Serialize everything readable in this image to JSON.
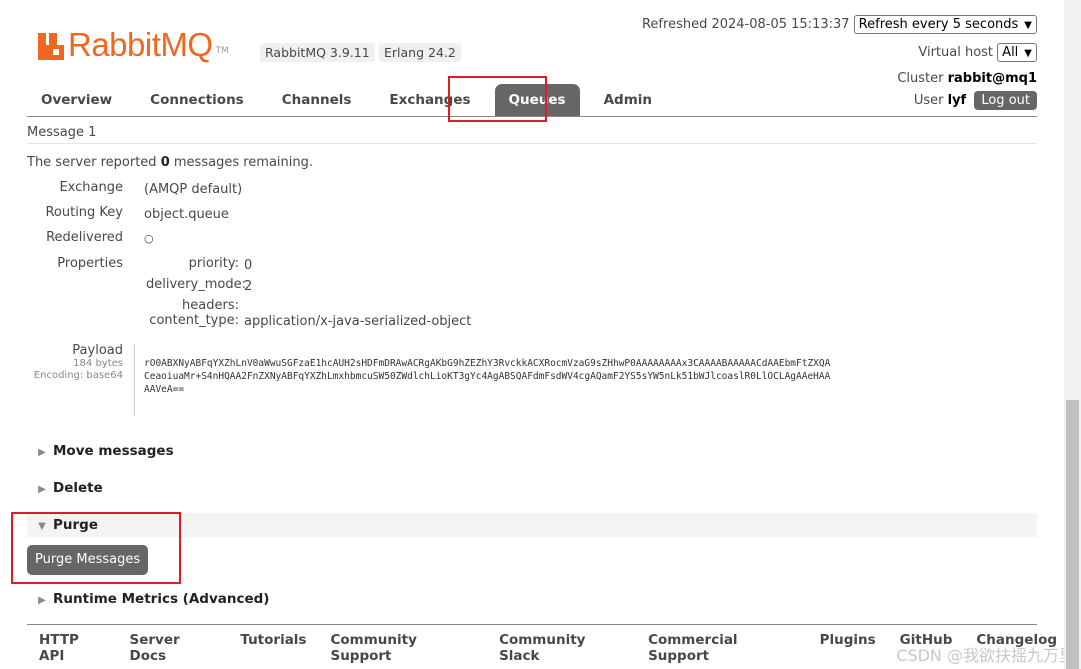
{
  "header": {
    "logo_text": "RabbitMQ",
    "logo_tm": "TM",
    "version": "RabbitMQ 3.9.11",
    "erlang": "Erlang 24.2",
    "refreshed_label": "Refreshed 2024-08-05 15:13:37",
    "refresh_select": "Refresh every 5 seconds",
    "vhost_label": "Virtual host",
    "vhost_select": "All",
    "cluster_label": "Cluster",
    "cluster_value": "rabbit@mq1",
    "user_label": "User",
    "user_value": "lyf",
    "logout_label": "Log out"
  },
  "tabs": [
    "Overview",
    "Connections",
    "Channels",
    "Exchanges",
    "Queues",
    "Admin"
  ],
  "message": {
    "heading": "Message 1",
    "remaining_prefix": "The server reported",
    "remaining_count": "0",
    "remaining_suffix": "messages remaining.",
    "exchange_label": "Exchange",
    "exchange_value": "(AMQP default)",
    "routing_key_label": "Routing Key",
    "routing_key_value": "object.queue",
    "redelivered_label": "Redelivered",
    "redelivered_value": "○",
    "properties_label": "Properties",
    "properties": {
      "priority_label": "priority:",
      "priority_value": "0",
      "delivery_mode_label": "delivery_mode:",
      "delivery_mode_value": "2",
      "headers_label": "headers:",
      "content_type_label": "content_type:",
      "content_type_value": "application/x-java-serialized-object"
    },
    "payload_label": "Payload",
    "payload_bytes": "184 bytes",
    "payload_encoding": "Encoding: base64",
    "payload_lines": [
      "rO0ABXNyABFqYXZhLnV0aWwuSGFzaE1hcAUH2sHDFmDRAwACRgAKbG9hZEZhY3RvckkACXRocmVzaG9sZHhwP0AAAAAAAAx3CAAAABAAAAACdAAEbmFtZXQA",
      "CeaoiuaMr+S4nHQAA2FnZXNyABFqYXZhLmxhbmcuSW50ZWdlchLioKT3gYc4AgABSQAFdmFsdWV4cgAQamF2YS5sYW5nLk51bWJlcoaslR0LlOCLAgAAeHAA",
      "AAVeA=="
    ]
  },
  "sections": {
    "move": "Move messages",
    "delete": "Delete",
    "purge": "Purge",
    "purge_button": "Purge Messages",
    "runtime": "Runtime Metrics (Advanced)"
  },
  "footer": [
    "HTTP API",
    "Server Docs",
    "Tutorials",
    "Community Support",
    "Community Slack",
    "Commercial Support",
    "Plugins",
    "GitHub",
    "Changelog"
  ],
  "watermark": "CSDN @我欲扶摇九万里",
  "colors": {
    "brand": "#f06820",
    "highlight": "#e01b24",
    "tab_active": "#666666"
  }
}
